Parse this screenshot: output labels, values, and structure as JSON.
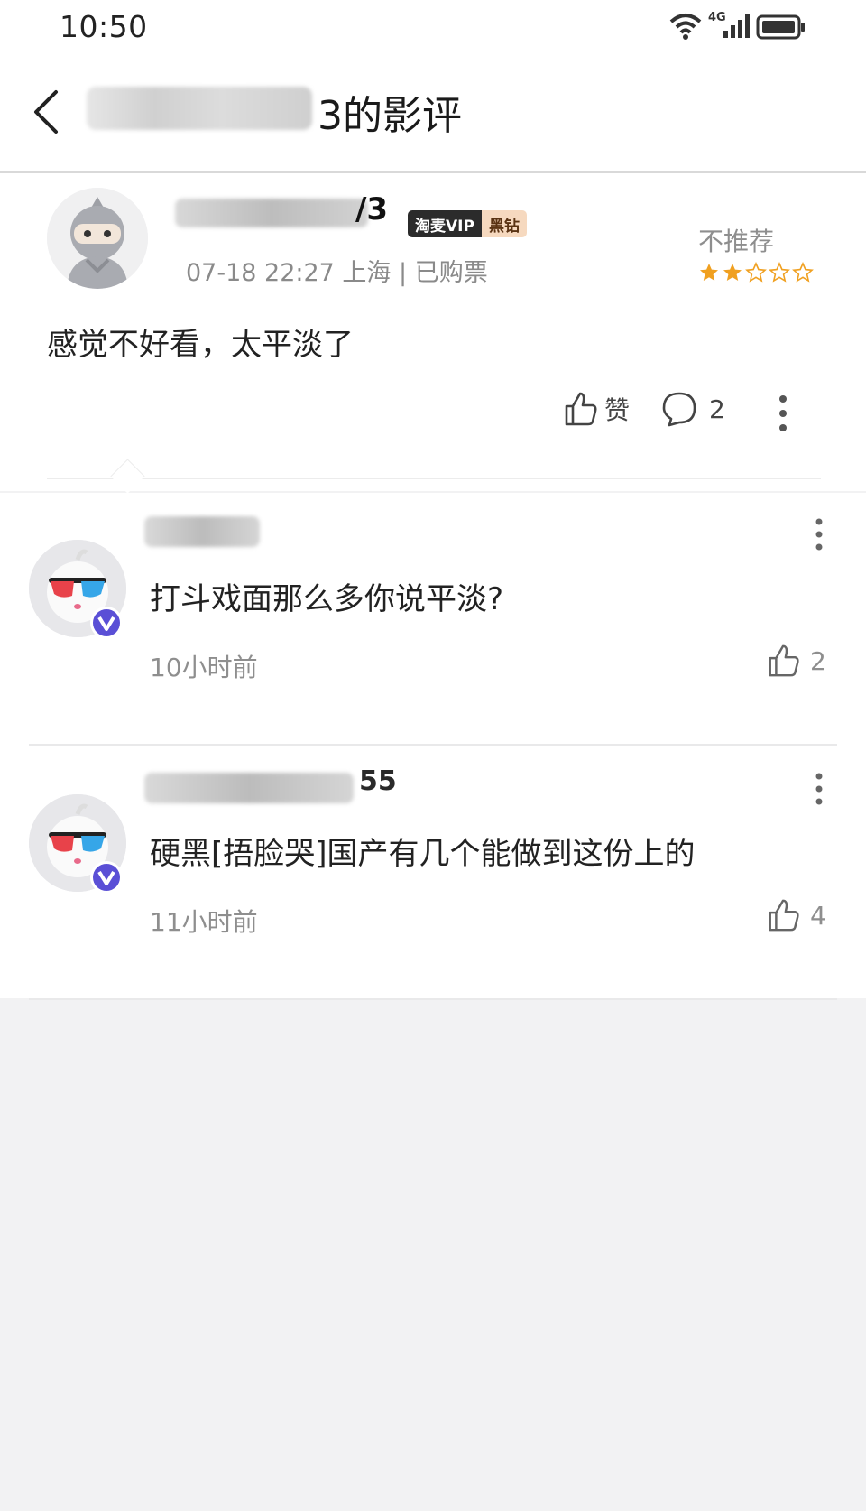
{
  "status_bar": {
    "time": "10:50",
    "network": "4G"
  },
  "header": {
    "title_suffix": "3的影评"
  },
  "review": {
    "username_suffix": "/3",
    "vip_badge_left": "淘麦VIP",
    "vip_badge_right": "黑钻",
    "meta": "07-18 22:27 上海 | 已购票",
    "recommendation": "不推荐",
    "rating_stars": 2,
    "rating_max": 5,
    "text": "感觉不好看，太平淡了",
    "like_label": "赞",
    "comment_count": "2"
  },
  "replies": [
    {
      "username_suffix": "",
      "text": "打斗戏面那么多你说平淡?",
      "time": "10小时前",
      "likes": "2"
    },
    {
      "username_suffix": "55",
      "text": "硬黑[捂脸哭]国产有几个能做到这份上的",
      "time": "11小时前",
      "likes": "4"
    }
  ],
  "colors": {
    "star": "#f0a020",
    "accent_badge": "#5a4fd6",
    "background": "#f2f2f3"
  }
}
